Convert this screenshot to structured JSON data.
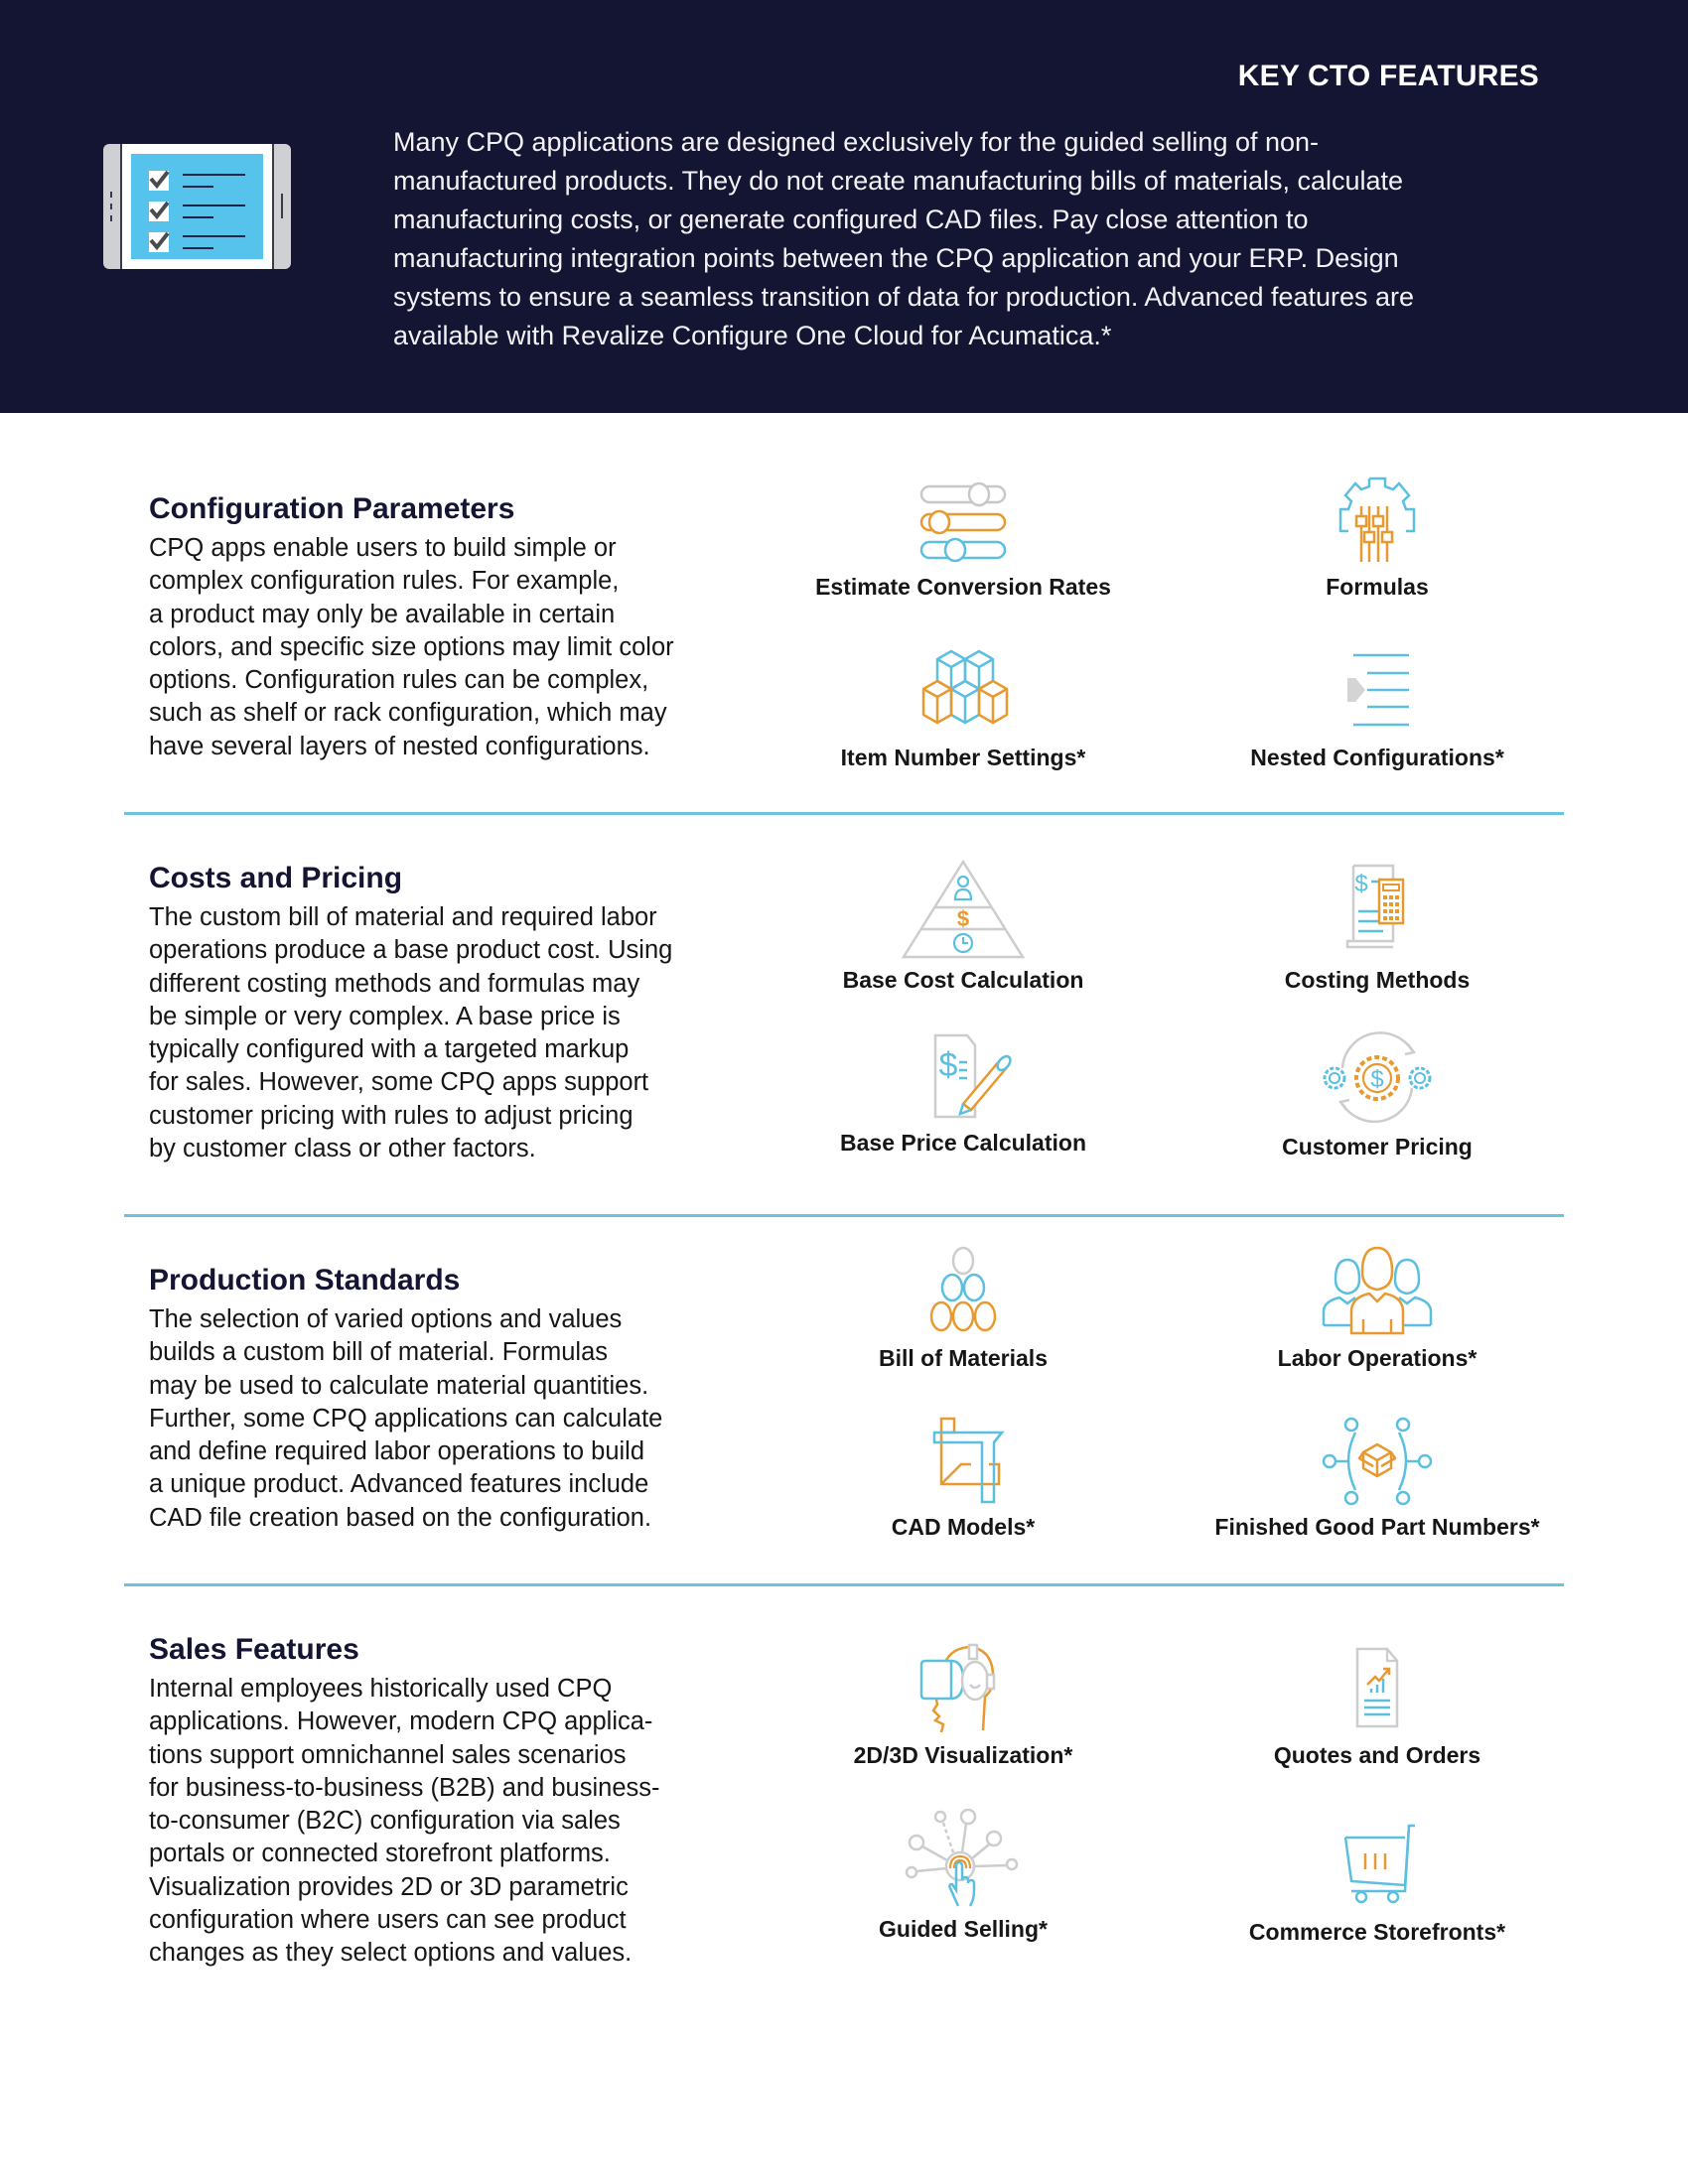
{
  "header": {
    "title": "KEY CTO FEATURES",
    "icon": "tablet-checklist-icon",
    "intro_lines": [
      "Many CPQ applications are designed exclusively for the guided selling of non-",
      "manufactured products. They do not create manufacturing bills of materials, calculate",
      "manufacturing costs, or generate configured CAD files. Pay close attention to",
      "manufacturing integration points between the CPQ application and your ERP. Design",
      "systems to ensure a seamless transition of data for production. Advanced features are",
      "available with Revalize Configure One Cloud for Acumatica.*"
    ]
  },
  "colors": {
    "header_bg": "#141433",
    "accent_blue": "#5bbfe0",
    "accent_orange": "#e8992f",
    "neutral_gray": "#c8c8c8",
    "divider": "#6cc3dd"
  },
  "sections": [
    {
      "title": "Configuration Parameters",
      "body_lines": [
        "CPQ apps enable users to build simple or",
        "complex configuration rules. For example,",
        "a product may only be available in certain",
        "colors, and specific size options may limit color",
        "options. Configuration rules can be complex,",
        "such as shelf or rack configuration, which may",
        "have several layers of nested configurations."
      ],
      "features": [
        {
          "label": "Estimate Conversion Rates",
          "icon": "sliders-icon"
        },
        {
          "label": "Formulas",
          "icon": "gear-sliders-icon"
        },
        {
          "label": "Item Number Settings*",
          "icon": "cubes-icon"
        },
        {
          "label": "Nested Configurations*",
          "icon": "indent-list-icon"
        }
      ]
    },
    {
      "title": "Costs and Pricing",
      "body_lines": [
        "The custom bill of material and required labor",
        "operations produce a base product cost. Using",
        "different costing methods and formulas may",
        "be simple or very complex. A base price is",
        "typically configured with a targeted markup",
        "for sales. However, some CPQ apps support",
        "customer pricing with rules to adjust pricing",
        "by customer class or other factors."
      ],
      "features": [
        {
          "label": "Base Cost Calculation",
          "icon": "pyramid-icon"
        },
        {
          "label": "Costing Methods",
          "icon": "calculator-document-icon"
        },
        {
          "label": "Base Price Calculation",
          "icon": "document-pencil-icon"
        },
        {
          "label": "Customer Pricing",
          "icon": "gears-dollar-icon"
        }
      ]
    },
    {
      "title": "Production Standards",
      "body_lines": [
        "The selection of varied options and values",
        "builds a custom bill of material. Formulas",
        "may be used to calculate material quantities.",
        "Further, some CPQ applications can calculate",
        "and define required labor operations to build",
        "a unique product. Advanced features include",
        "CAD file creation based on the configuration."
      ],
      "features": [
        {
          "label": "Bill of Materials",
          "icon": "stacked-circles-icon"
        },
        {
          "label": "Labor Operations*",
          "icon": "people-group-icon"
        },
        {
          "label": "CAD Models*",
          "icon": "cad-shapes-icon"
        },
        {
          "label": "Finished Good Part Numbers*",
          "icon": "box-network-icon"
        }
      ]
    },
    {
      "title": "Sales Features",
      "body_lines": [
        "Internal employees historically used CPQ",
        "applications. However, modern CPQ applica-",
        "tions support omnichannel sales scenarios",
        "for business-to-business (B2B) and business-",
        "to-consumer (B2C) configuration via sales",
        "portals or connected storefront platforms.",
        "Visualization provides 2D or 3D parametric",
        "configuration where users can see product",
        "changes as they select options and values."
      ],
      "features": [
        {
          "label": "2D/3D Visualization*",
          "icon": "vr-headset-icon"
        },
        {
          "label": "Quotes and Orders",
          "icon": "report-document-icon"
        },
        {
          "label": "Guided Selling*",
          "icon": "touch-network-icon"
        },
        {
          "label": "Commerce Storefronts*",
          "icon": "shopping-cart-icon"
        }
      ]
    }
  ]
}
